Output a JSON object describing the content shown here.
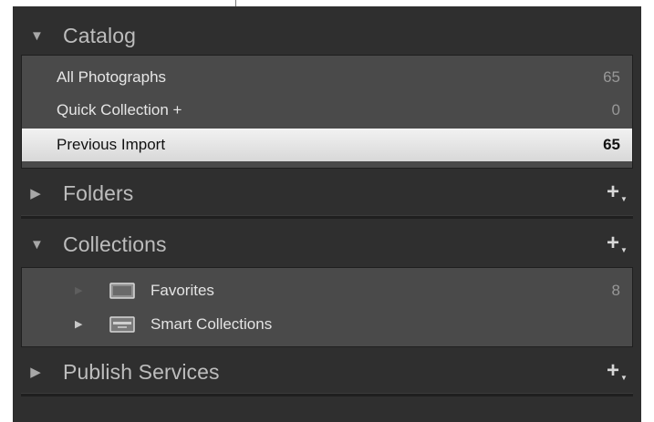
{
  "sections": {
    "catalog": {
      "title": "Catalog",
      "expanded": true,
      "items": [
        {
          "label": "All Photographs",
          "count": "65"
        },
        {
          "label": "Quick Collection +",
          "count": "0"
        },
        {
          "label": "Previous Import",
          "count": "65",
          "selected": true
        }
      ]
    },
    "folders": {
      "title": "Folders",
      "expanded": false,
      "add_label": "+"
    },
    "collections": {
      "title": "Collections",
      "expanded": true,
      "add_label": "+",
      "items": [
        {
          "label": "Favorites",
          "count": "8",
          "icon": "collection-set-icon"
        },
        {
          "label": "Smart Collections",
          "icon": "smart-collection-set-icon"
        }
      ]
    },
    "publish_services": {
      "title": "Publish Services",
      "expanded": false,
      "add_label": "+"
    }
  },
  "icons": {
    "expanded": "triangle-down-icon",
    "collapsed": "triangle-right-icon"
  },
  "colors": {
    "panel": "#2f2f2f",
    "section_body": "#4a4a4a",
    "selected_row": "#e6e6e6",
    "header_text": "#bdbdbd"
  }
}
